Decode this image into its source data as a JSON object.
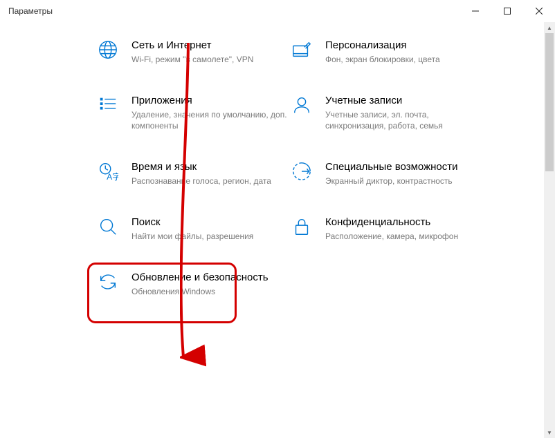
{
  "window": {
    "title": "Параметры"
  },
  "tiles": {
    "network": {
      "title": "Сеть и Интернет",
      "sub": "Wi-Fi, режим \"в самолете\", VPN"
    },
    "personalization": {
      "title": "Персонализация",
      "sub": "Фон, экран блокировки, цвета"
    },
    "apps": {
      "title": "Приложения",
      "sub": "Удаление, значения по умолчанию, доп. компоненты"
    },
    "accounts": {
      "title": "Учетные записи",
      "sub": "Учетные записи, эл. почта, синхронизация, работа, семья"
    },
    "time": {
      "title": "Время и язык",
      "sub": "Распознавание голоса, регион, дата"
    },
    "ease": {
      "title": "Специальные возможности",
      "sub": "Экранный диктор, контрастность"
    },
    "search": {
      "title": "Поиск",
      "sub": "Найти мои файлы, разрешения"
    },
    "privacy": {
      "title": "Конфиденциальность",
      "sub": "Расположение, камера, микрофон"
    },
    "update": {
      "title": "Обновление и безопасность",
      "sub": "Обновления Windows"
    }
  }
}
